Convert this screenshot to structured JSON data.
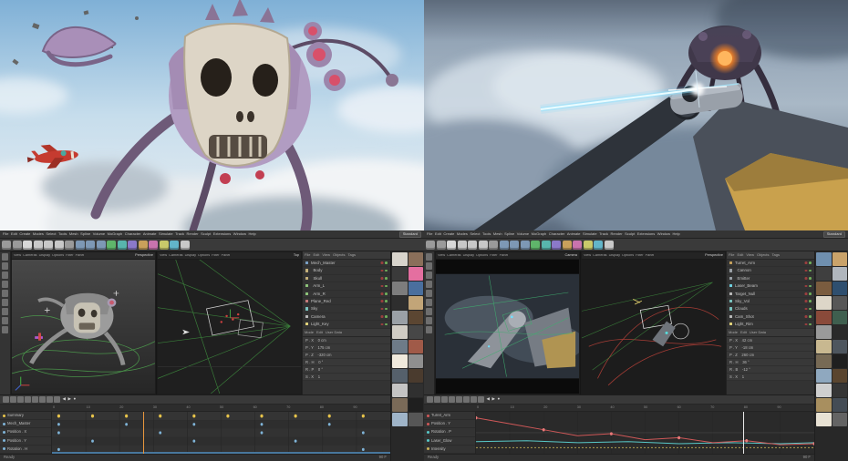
{
  "c4d": {
    "menus": [
      "File",
      "Edit",
      "Create",
      "Modes",
      "Select",
      "Tools",
      "Mesh",
      "Spline",
      "Volume",
      "MoGraph",
      "Character",
      "Animate",
      "Simulate",
      "Track",
      "Render",
      "Sculpt",
      "Extensions",
      "Window",
      "Help"
    ],
    "layout_selector": "Standard",
    "viewport_menus": [
      "View",
      "Cameras",
      "Display",
      "Options",
      "Filter",
      "Panel"
    ],
    "object_manager_menus": [
      "File",
      "Edit",
      "View",
      "Objects",
      "Tags"
    ],
    "attribute_tabs": [
      "Mode",
      "Edit",
      "User Data"
    ],
    "transport": [
      "◀",
      "▶",
      "●"
    ],
    "toolbar_icons": [
      {
        "name": "undo-icon",
        "color": "#9a9a9a"
      },
      {
        "name": "redo-icon",
        "color": "#9a9a9a"
      },
      {
        "name": "live-selection-icon",
        "color": "#d8d8d8"
      },
      {
        "name": "move-tool-icon",
        "color": "#c8c8c8"
      },
      {
        "name": "scale-tool-icon",
        "color": "#c8c8c8"
      },
      {
        "name": "rotate-tool-icon",
        "color": "#c8c8c8"
      },
      {
        "name": "last-tool-icon",
        "color": "#9a9a9a"
      },
      {
        "name": "render-view-icon",
        "color": "#7d98b5"
      },
      {
        "name": "render-picture-viewer-icon",
        "color": "#7d98b5"
      },
      {
        "name": "render-settings-icon",
        "color": "#7d98b5"
      },
      {
        "name": "add-cube-icon",
        "color": "#5fb56a"
      },
      {
        "name": "add-spline-icon",
        "color": "#58b5ad"
      },
      {
        "name": "add-generator-icon",
        "color": "#8b79c9"
      },
      {
        "name": "add-deformer-icon",
        "color": "#c9a05b"
      },
      {
        "name": "mograph-icon",
        "color": "#c973ae"
      },
      {
        "name": "volume-icon",
        "color": "#c9c96a"
      },
      {
        "name": "simulate-icon",
        "color": "#62b5c9"
      },
      {
        "name": "camera-light-icon",
        "color": "#c9c9c9"
      }
    ],
    "mode_icons": [
      "#6e6e6e",
      "#6e6e6e",
      "#6e6e6e",
      "#6e6e6e",
      "#6e6e6e",
      "#6e6e6e",
      "#6e6e6e",
      "#6e6e6e",
      "#6e6e6e"
    ],
    "timeline_icons": [
      "#707070",
      "#707070",
      "#707070",
      "#707070",
      "#707070",
      "#707070",
      "#707070",
      "#707070"
    ]
  },
  "ws_left": {
    "viewports": [
      {
        "label": "Perspective"
      },
      {
        "label": "Top"
      }
    ],
    "objects": [
      {
        "label": "Mech_Master",
        "color": "#7aa0c4"
      },
      {
        "label": "  Body",
        "color": "#c4b07a"
      },
      {
        "label": "  Skull",
        "color": "#c4b07a"
      },
      {
        "label": "  Arm_L",
        "color": "#8ec47a"
      },
      {
        "label": "  Arm_R",
        "color": "#8ec47a"
      },
      {
        "label": "Plane_Red",
        "color": "#c47a7a"
      },
      {
        "label": "Sky",
        "color": "#7ac4c0"
      },
      {
        "label": "Camera",
        "color": "#b8b8b8"
      },
      {
        "label": "Light_Key",
        "color": "#e0d27a"
      }
    ],
    "attr_rows": [
      "P . X    0 cm",
      "P . Y    175 cm",
      "P . Z    -320 cm",
      "R . H    0 °",
      "R . P    0 °",
      "S . X    1"
    ],
    "materials": [
      "#d8d4cc",
      "#8a6f5a",
      "#3a3a3a",
      "#e46fa0",
      "#7d7d7d",
      "#4a6f9e",
      "#2e2e2e",
      "#c2a578",
      "#9aa0a6",
      "#5b4632",
      "#d0ccc4",
      "#474747",
      "#6e7b88",
      "#a05a48",
      "#efe9dc",
      "#8f8f8f",
      "#55606b",
      "#4a3b2e",
      "#c4c4c4",
      "#303030",
      "#7a6a58",
      "#1f1f1f",
      "#9fb4c8",
      "#565656"
    ],
    "timeline_ruler": [
      "0",
      "10",
      "20",
      "30",
      "40",
      "50",
      "60",
      "70",
      "80",
      "90"
    ],
    "tracks": [
      {
        "label": "Summary",
        "color": "#e8c44a"
      },
      {
        "label": "Mech_Master",
        "color": "#7fb4d8"
      },
      {
        "label": "Position . X",
        "color": "#7fb4d8"
      },
      {
        "label": "Position . Y",
        "color": "#7fb4d8"
      },
      {
        "label": "Rotation . H",
        "color": "#7fb4d8"
      }
    ],
    "playhead_pct": 27,
    "status_left": "Ready",
    "status_right": "90 F"
  },
  "ws_right": {
    "viewports": [
      {
        "label": "Camera"
      },
      {
        "label": "Perspective"
      }
    ],
    "objects": [
      {
        "label": "Turret_Arm",
        "color": "#c4a05b"
      },
      {
        "label": "  Cannon",
        "color": "#9aa0a6"
      },
      {
        "label": "  Emitter",
        "color": "#9aa0a6"
      },
      {
        "label": "Laser_Beam",
        "color": "#6fd0e0"
      },
      {
        "label": "Target_Null",
        "color": "#b8b8b8"
      },
      {
        "label": "Sky_Vol",
        "color": "#7ac4c0"
      },
      {
        "label": "Clouds",
        "color": "#7ac4c0"
      },
      {
        "label": "Cam_Shot",
        "color": "#b8b8b8"
      },
      {
        "label": "Light_Rim",
        "color": "#e0d27a"
      }
    ],
    "attr_rows": [
      "P . X    42 cm",
      "P . Y    -18 cm",
      "P . Z    260 cm",
      "R . H    36 °",
      "R . B    -12 °",
      "S . X    1"
    ],
    "materials": [
      "#6f8fae",
      "#caa36a",
      "#3f3f3f",
      "#b0b6bd",
      "#7a5c3f",
      "#2f4f6f",
      "#ddd6c8",
      "#575757",
      "#8a4a3a",
      "#3f5f4f",
      "#9a9a9a",
      "#2a2a2a",
      "#c8b890",
      "#4e565e",
      "#776a55",
      "#1f1f1f",
      "#8fa8bf",
      "#5a452f",
      "#cfcfcf",
      "#353535",
      "#a88f5f",
      "#444c55",
      "#e8e2d4",
      "#646464"
    ],
    "timeline_ruler": [
      "0",
      "10",
      "20",
      "30",
      "40",
      "50",
      "60",
      "70",
      "80",
      "90"
    ],
    "tracks": [
      {
        "label": "Turret_Arm",
        "color": "#d05858"
      },
      {
        "label": "Position . Y",
        "color": "#d05858"
      },
      {
        "label": "Rotation . P",
        "color": "#58c8c8"
      },
      {
        "label": "Laser_Glow",
        "color": "#58c8c8"
      },
      {
        "label": "Intensity",
        "color": "#c8b058"
      }
    ],
    "curves": {
      "red": [
        [
          0,
          6
        ],
        [
          40,
          12
        ],
        [
          80,
          18
        ],
        [
          120,
          24
        ],
        [
          160,
          22
        ],
        [
          200,
          28
        ],
        [
          240,
          26
        ],
        [
          280,
          31
        ],
        [
          320,
          29
        ],
        [
          360,
          33
        ],
        [
          400,
          32
        ]
      ],
      "cyan": [
        [
          0,
          30
        ],
        [
          60,
          29
        ],
        [
          120,
          31
        ],
        [
          180,
          30
        ],
        [
          240,
          32
        ],
        [
          300,
          31
        ],
        [
          360,
          32
        ],
        [
          400,
          31
        ]
      ],
      "yellow": [
        [
          0,
          36
        ],
        [
          400,
          36
        ]
      ]
    },
    "playhead_pct": 79,
    "status_left": "Ready",
    "status_right": "90 F"
  }
}
